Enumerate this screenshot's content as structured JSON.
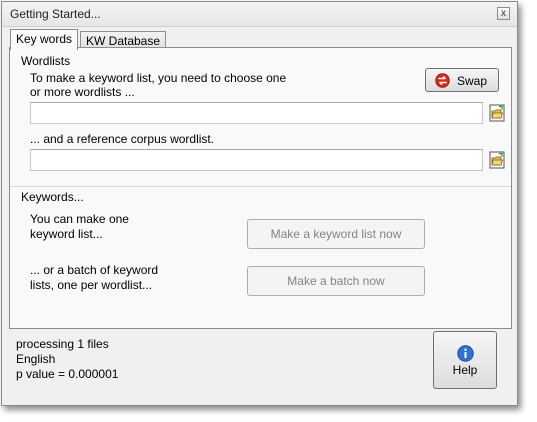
{
  "window": {
    "title": "Getting Started...",
    "close_glyph": "x"
  },
  "tabs": [
    {
      "label": "Key words",
      "active": true
    },
    {
      "label": "KW Database",
      "active": false
    }
  ],
  "wordlists": {
    "group_title": "Wordlists",
    "instruction_line1": "To make a keyword list, you need to choose one",
    "instruction_line2": "or more wordlists ...",
    "wordlist_value": "",
    "reference_label": "... and a reference corpus wordlist.",
    "reference_value": "",
    "swap_label": "Swap",
    "swap_icon": "swap-arrows-icon",
    "browse_icon": "open-folder-icon"
  },
  "keywords": {
    "group_title": "Keywords...",
    "one_line1": "You can make one",
    "one_line2": "keyword list...",
    "make_one_label": "Make a keyword list now",
    "batch_line1": "... or a batch of keyword",
    "batch_line2": "lists, one per wordlist...",
    "make_batch_label": "Make a batch now"
  },
  "status": {
    "line1": "processing 1 files",
    "line2": "English",
    "line3": "p value = 0.000001"
  },
  "help": {
    "label": "Help",
    "icon": "info-icon"
  },
  "colors": {
    "window_bg": "#f0f0f0",
    "panel_bg": "#f9f9f9",
    "disabled_text": "#838383",
    "swap_red": "#d42a1e",
    "info_blue": "#2f6fd6"
  }
}
